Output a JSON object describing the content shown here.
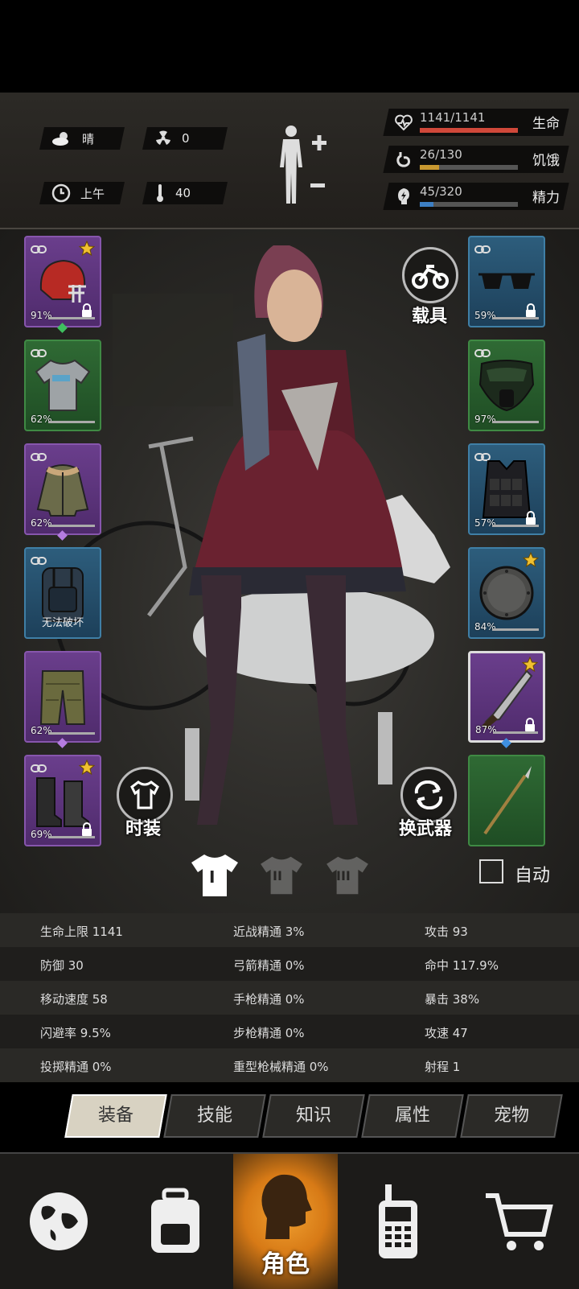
{
  "status": {
    "weather": {
      "icon": "cloud-sun-icon",
      "label": "晴"
    },
    "radiation": {
      "icon": "radiation-icon",
      "value": "0"
    },
    "time": {
      "icon": "clock-icon",
      "label": "上午"
    },
    "temperature": {
      "icon": "thermometer-icon",
      "value": "40"
    },
    "vitals": [
      {
        "icon": "heart-icon",
        "value": "1141/1141",
        "label": "生命",
        "fill": 1.0,
        "color": "#d0483a"
      },
      {
        "icon": "stomach-icon",
        "value": "26/130",
        "label": "饥饿",
        "fill": 0.2,
        "color": "#c89830"
      },
      {
        "icon": "energy-icon",
        "value": "45/320",
        "label": "精力",
        "fill": 0.14,
        "color": "#3d7fc4"
      }
    ]
  },
  "left_slots": [
    {
      "item": "helmet",
      "pct": "91%",
      "rarity": "purple",
      "star": true,
      "lock": true,
      "gem": "#3fbf5f"
    },
    {
      "item": "tshirt",
      "pct": "62%",
      "rarity": "green",
      "star": false,
      "lock": false,
      "gem": ""
    },
    {
      "item": "jacket",
      "pct": "62%",
      "rarity": "purple",
      "star": false,
      "lock": false,
      "gem": "#b57ce0"
    },
    {
      "item": "backpack",
      "text": "无法破坏",
      "rarity": "blue",
      "star": false,
      "lock": false,
      "gem": ""
    },
    {
      "item": "pants",
      "pct": "62%",
      "rarity": "purple",
      "star": false,
      "lock": false,
      "gem": "#b57ce0"
    },
    {
      "item": "boots",
      "pct": "69%",
      "rarity": "purple",
      "star": true,
      "lock": true,
      "gem": ""
    }
  ],
  "right_slots": [
    {
      "item": "sunglasses",
      "pct": "59%",
      "rarity": "blue",
      "star": false,
      "lock": true,
      "gem": ""
    },
    {
      "item": "gas-mask",
      "pct": "97%",
      "rarity": "green",
      "star": false,
      "lock": false,
      "gem": ""
    },
    {
      "item": "vest",
      "pct": "57%",
      "rarity": "blue",
      "star": false,
      "lock": true,
      "gem": ""
    },
    {
      "item": "shield",
      "pct": "84%",
      "rarity": "blue",
      "star": true,
      "lock": false,
      "gem": ""
    },
    {
      "item": "machete",
      "pct": "87%",
      "rarity": "purple",
      "star": true,
      "lock": true,
      "gem": "#3f8fe0"
    },
    {
      "item": "spear",
      "pct": "",
      "rarity": "green",
      "star": false,
      "lock": false,
      "gem": ""
    }
  ],
  "buttons": {
    "vehicle": "载具",
    "fashion": "时装",
    "swap_weapon": "换武器",
    "auto": "自动"
  },
  "outfits": [
    "I",
    "II",
    "III"
  ],
  "stats": [
    [
      "生命上限 1141",
      "近战精通 3%",
      "攻击 93"
    ],
    [
      "防御 30",
      "弓箭精通 0%",
      "命中 117.9%"
    ],
    [
      "移动速度 58",
      "手枪精通 0%",
      "暴击 38%"
    ],
    [
      "闪避率 9.5%",
      "步枪精通 0%",
      "攻速 47"
    ],
    [
      "投掷精通 0%",
      "重型枪械精通 0%",
      "射程 1"
    ]
  ],
  "tabs": [
    "装备",
    "技能",
    "知识",
    "属性",
    "宠物"
  ],
  "nav": {
    "world": "globe-icon",
    "inventory": "backpack-icon",
    "character": "角色",
    "radio": "walkie-talkie-icon",
    "shop": "cart-icon"
  }
}
